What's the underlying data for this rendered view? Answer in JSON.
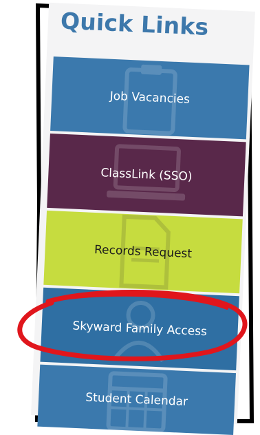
{
  "panel": {
    "title": "Quick Links"
  },
  "links": [
    {
      "label": "Job Vacancies"
    },
    {
      "label": "ClassLink (SSO)"
    },
    {
      "label": "Records Request"
    },
    {
      "label": "Skyward Family Access"
    },
    {
      "label": "Student Calendar"
    }
  ],
  "colors": {
    "title": "#3d78ab",
    "job_vacancies": "#3b79ad",
    "classlink": "#59284a",
    "records_request": "#c6dc3f",
    "skyward": "#2f6fa3",
    "student_calendar": "#3b79ad",
    "annotation": "#e0161c"
  },
  "icons": [
    "clipboard-watermark-icon",
    "laptop-watermark-icon",
    "document-watermark-icon",
    "calendar-watermark-icon"
  ]
}
